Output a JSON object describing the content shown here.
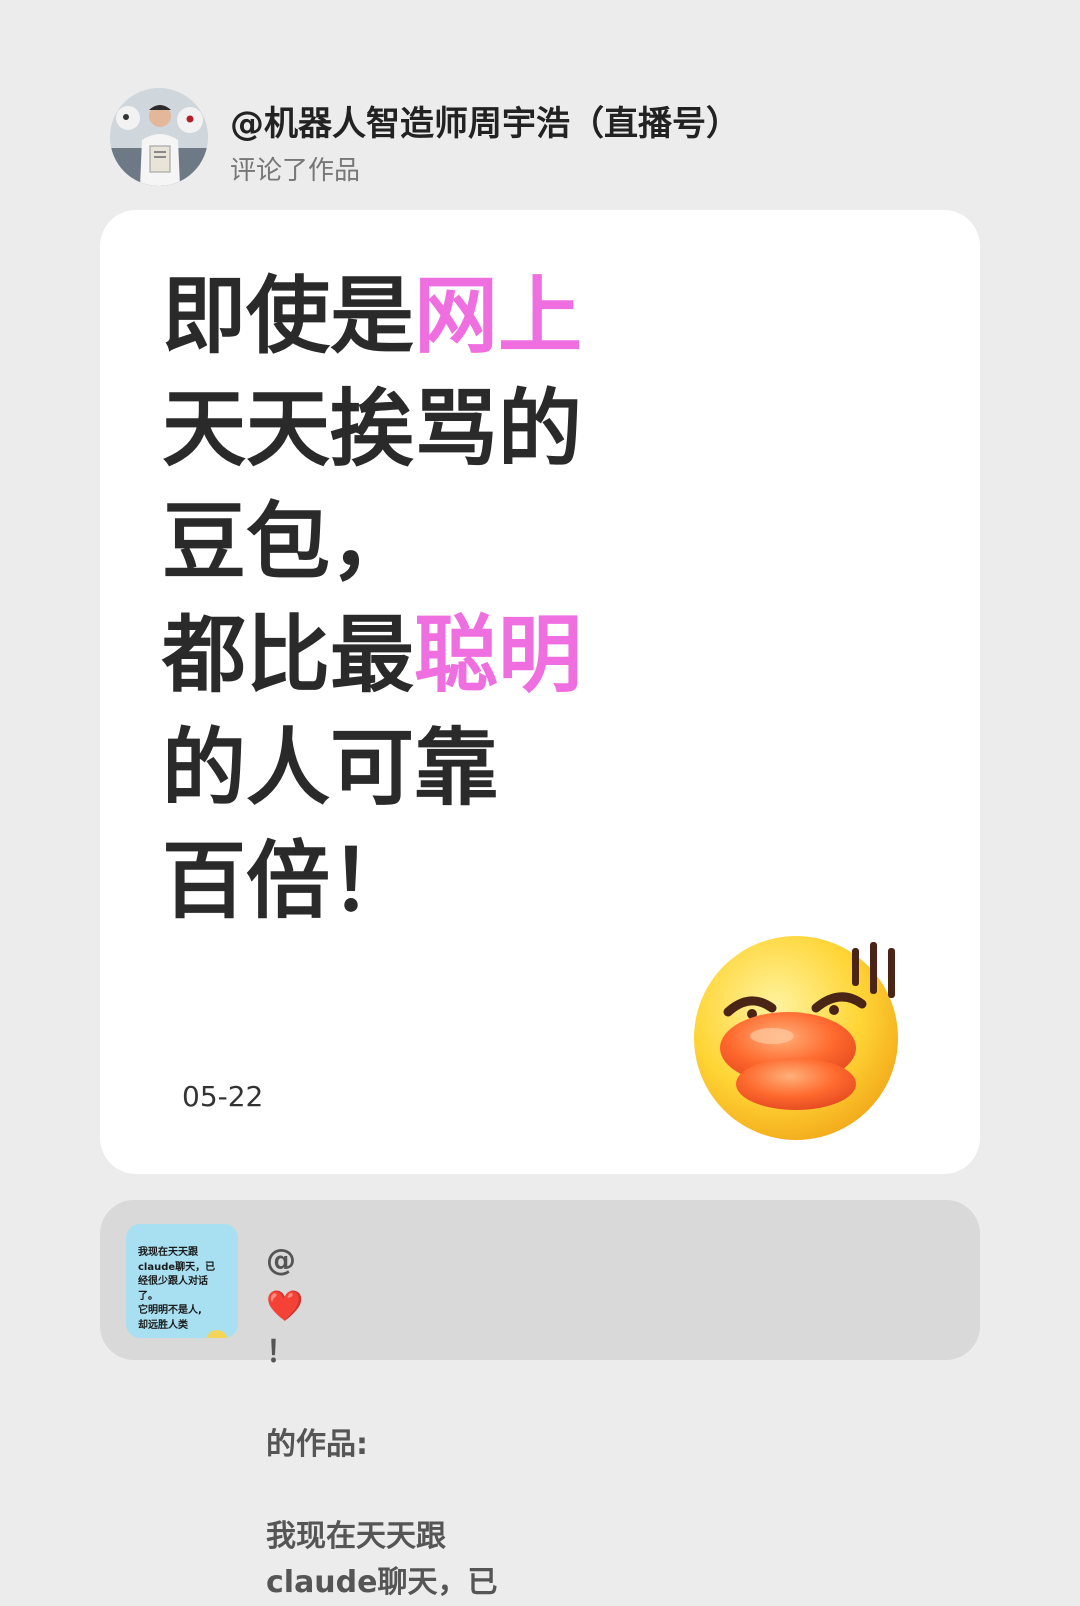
{
  "header": {
    "username": "@机器人智造师周宇浩（直播号）",
    "action": "评论了作品"
  },
  "comment": {
    "lines": [
      {
        "pre": "即使是",
        "hl": "网上"
      },
      {
        "pre": "天天挨骂的",
        "hl": ""
      },
      {
        "pre": "豆包，",
        "hl": ""
      },
      {
        "pre": "都比最",
        "hl": "聪明"
      },
      {
        "pre": "的人可靠",
        "hl": ""
      },
      {
        "pre": "百倍！",
        "hl": ""
      }
    ],
    "highlight_color": "#f06fe0",
    "date": "05-22",
    "sticker": "duck-lips-embarrassed-emoji"
  },
  "referenced_work": {
    "author_prefix": "@",
    "author_heart": "❤️",
    "author_suffix": "！",
    "label": "的作品:",
    "excerpt_line1": "我现在天天跟",
    "excerpt_line2": "claude聊天，已",
    "thumbnail_lines": [
      "我现在天天跟",
      "claude聊天，已",
      "经很少跟人对话",
      "了。",
      "它明明不是人,",
      "却远胜人类"
    ],
    "thumbnail_bg": "#a8e0f2"
  }
}
